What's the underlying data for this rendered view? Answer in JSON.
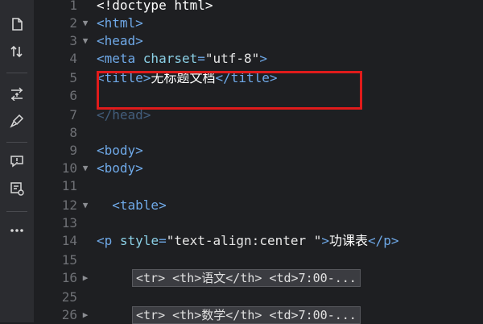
{
  "lines": [
    {
      "num": "1",
      "fold": "",
      "code": [
        {
          "t": "<!doctype html>",
          "c": "txt"
        }
      ]
    },
    {
      "num": "2",
      "fold": "▼",
      "code": [
        {
          "t": "<html>",
          "c": "tag"
        }
      ]
    },
    {
      "num": "3",
      "fold": "▼",
      "code": [
        {
          "t": "<head>",
          "c": "tag"
        }
      ]
    },
    {
      "num": "4",
      "fold": "",
      "code": [
        {
          "t": "<meta ",
          "c": "tag"
        },
        {
          "t": "charset",
          "c": "attr"
        },
        {
          "t": "=",
          "c": "tag"
        },
        {
          "t": "\"utf-8\"",
          "c": "str"
        },
        {
          "t": ">",
          "c": "tag"
        }
      ]
    },
    {
      "num": "5",
      "fold": "",
      "code": [
        {
          "t": "<title>",
          "c": "tag"
        },
        {
          "t": "无标题文档",
          "c": "txt"
        },
        {
          "t": "</title>",
          "c": "tag"
        }
      ]
    },
    {
      "num": "6",
      "fold": "",
      "code": []
    },
    {
      "num": "7",
      "fold": "",
      "code": [
        {
          "t": "</head>",
          "c": "tag"
        }
      ]
    },
    {
      "num": "8",
      "fold": "",
      "code": []
    },
    {
      "num": "9",
      "fold": "",
      "code": [
        {
          "t": "<body>",
          "c": "tag"
        }
      ]
    },
    {
      "num": "10",
      "fold": "▼",
      "code": [
        {
          "t": "<body>",
          "c": "tag"
        }
      ]
    },
    {
      "num": "11",
      "fold": "",
      "code": []
    },
    {
      "num": "12",
      "fold": "▼",
      "code": [
        {
          "t": "  <table>",
          "c": "tag"
        }
      ]
    },
    {
      "num": "13",
      "fold": "",
      "code": []
    },
    {
      "num": "14",
      "fold": "",
      "code": [
        {
          "t": "<p ",
          "c": "tag"
        },
        {
          "t": "style",
          "c": "attr"
        },
        {
          "t": "=",
          "c": "tag"
        },
        {
          "t": "\"text-align:center \"",
          "c": "str"
        },
        {
          "t": ">",
          "c": "tag"
        },
        {
          "t": "功课表",
          "c": "txt"
        },
        {
          "t": "</p>",
          "c": "tag"
        }
      ]
    },
    {
      "num": "15",
      "fold": "",
      "code": []
    },
    {
      "num": "16",
      "fold": "▶",
      "collapsed": "<tr> <th>语文</th> <td>7:00-..."
    },
    {
      "num": "25",
      "fold": "",
      "code": []
    },
    {
      "num": "26",
      "fold": "▶",
      "collapsed": "<tr> <th>数学</th> <td>7:00-..."
    }
  ]
}
